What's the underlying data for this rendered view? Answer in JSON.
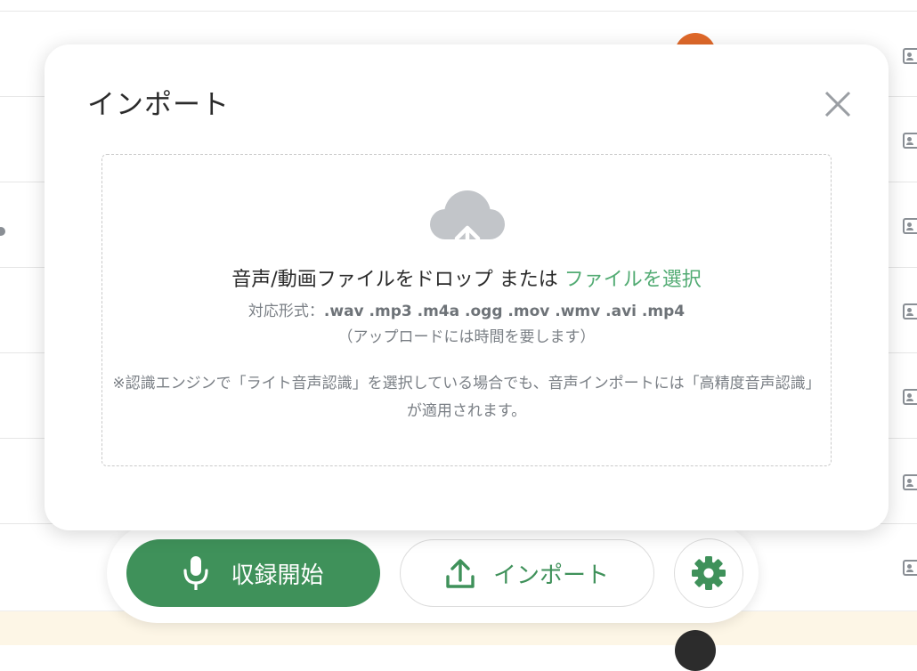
{
  "modal": {
    "title": "インポート",
    "drop_text": "音声/動画ファイルをドロップ または",
    "select_file_link": "ファイルを選択",
    "formats_label": "対応形式：",
    "formats": ".wav .mp3 .m4a .ogg .mov .wmv .avi .mp4",
    "upload_note": "（アップロードには時間を要します）",
    "engine_notice": "※認識エンジンで「ライト音声認識」を選択している場合でも、音声インポートには「高精度音声認識」が適用されます。"
  },
  "toolbar": {
    "record_label": "収録開始",
    "import_label": "インポート"
  },
  "icons": {
    "close": "close-icon",
    "cloud_upload": "cloud-upload-icon",
    "mic": "microphone-icon",
    "upload": "upload-icon",
    "settings": "gear-icon",
    "row": "contact-document-icon"
  },
  "colors": {
    "accent_green": "#3f915a",
    "link_green": "#52ab73",
    "avatar_orange": "#e0692a",
    "highlight_row": "#fdf6e6"
  }
}
